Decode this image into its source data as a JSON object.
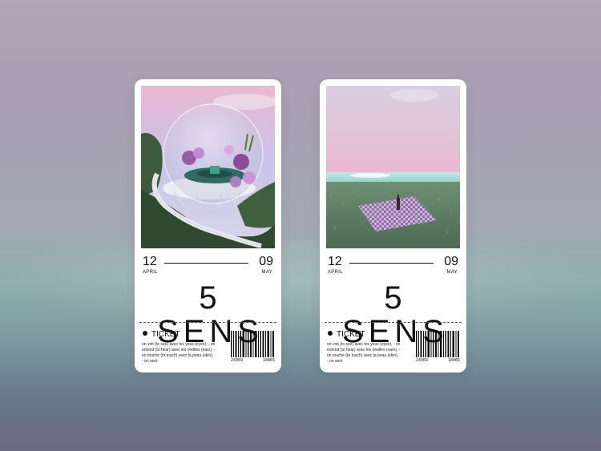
{
  "tickets": [
    {
      "start_day": "12",
      "start_month": "APRIL",
      "end_day": "09",
      "end_month": "MAY",
      "brand": "5 SENS",
      "ticket_label": "TICKET",
      "description": "on voit (to see) avec les yeux (eyes), - on entend (to hear) avec les oreilles (ears), - on touche (to touch) avec la peau (skin), - on sent",
      "barcode_left": "24369",
      "barcode_right": "18465",
      "image": "glass-dome-garden-photo"
    },
    {
      "start_day": "12",
      "start_month": "APRIL",
      "end_day": "09",
      "end_month": "MAY",
      "brand": "5 SENS",
      "ticket_label": "TICKET",
      "description": "on voit (to see) avec les yeux (eyes), - on entend (to hear) avec les oreilles (ears), - on touche (to touch) avec la peau (skin), - on sent",
      "barcode_left": "24369",
      "barcode_right": "18465",
      "image": "picnic-blanket-meadow-photo"
    }
  ],
  "colors": {
    "background_top": "#b3a4b7",
    "background_bottom": "#667a87",
    "ticket": "#ffffff",
    "ink": "#111111"
  }
}
